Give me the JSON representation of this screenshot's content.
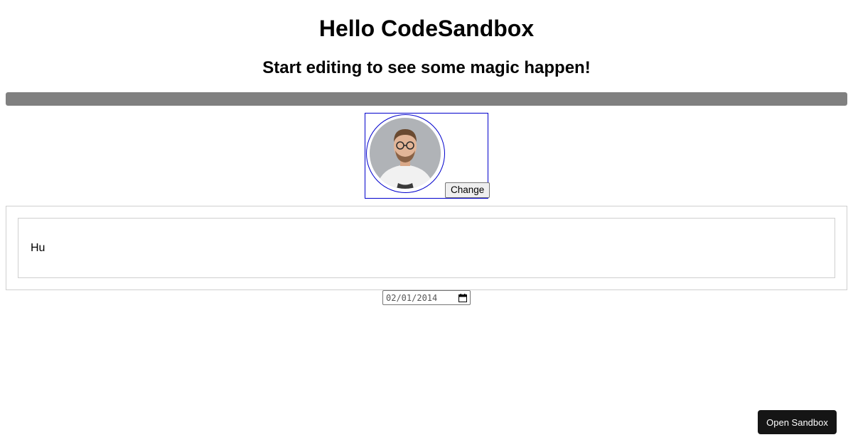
{
  "header": {
    "title": "Hello CodeSandbox",
    "subtitle": "Start editing to see some magic happen!"
  },
  "progress": {
    "value_percent": 100,
    "fill_color": "#808080"
  },
  "avatar": {
    "change_label": "Change",
    "border_color": "#0000cc"
  },
  "card": {
    "text": "Hu"
  },
  "date_field": {
    "value": "02/01/2014",
    "icon": "calendar-icon"
  },
  "footer": {
    "open_sandbox_label": "Open Sandbox"
  }
}
